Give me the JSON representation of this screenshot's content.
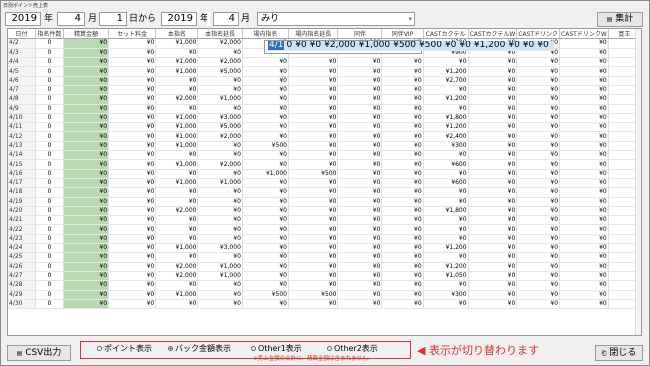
{
  "window_title": "日別ポイント売上表",
  "filter": {
    "from_year": "2019",
    "year_label1": "年",
    "from_month": "4",
    "month_label1": "月",
    "from_day": "1",
    "from_label": "日から",
    "to_year": "2019",
    "year_label2": "年",
    "to_month": "4",
    "month_label2": "月",
    "to_day": "30",
    "to_label": "日まで",
    "cast": "みり"
  },
  "buttons": {
    "aggregate": "集計",
    "csv": "CSV出力",
    "close": "閉じる"
  },
  "columns": [
    "日付",
    "指名件数",
    "精算金額",
    "セット料金",
    "本指名",
    "本指名延長",
    "場内指名",
    "場内指名延長",
    "同伴",
    "同伴VIP",
    "CASTカクテル",
    "CASTカクテルW",
    "CASTドリンク",
    "CASTドリンクW",
    "寛王"
  ],
  "rows": [
    [
      "4/1",
      "0",
      "¥0",
      "¥0",
      "¥2,000",
      "¥1,000",
      "¥500",
      "¥500",
      "¥0",
      "¥0",
      "¥1,200",
      "¥0",
      "¥0",
      "¥0",
      ""
    ],
    [
      "4/2",
      "0",
      "¥0",
      "¥0",
      "¥1,000",
      "¥2,000",
      "¥0",
      "¥0",
      "¥4,000",
      "¥0",
      "¥300",
      "¥0",
      "¥0",
      "¥0",
      ""
    ],
    [
      "4/3",
      "0",
      "¥0",
      "¥0",
      "¥0",
      "¥0",
      "¥0",
      "¥0",
      "¥0",
      "¥0",
      "¥900",
      "¥0",
      "¥0",
      "¥0",
      ""
    ],
    [
      "4/4",
      "0",
      "¥0",
      "¥0",
      "¥1,000",
      "¥2,000",
      "¥0",
      "¥0",
      "¥0",
      "¥0",
      "¥0",
      "¥0",
      "¥0",
      "¥0",
      ""
    ],
    [
      "4/5",
      "0",
      "¥0",
      "¥0",
      "¥1,000",
      "¥5,000",
      "¥0",
      "¥0",
      "¥0",
      "¥0",
      "¥1,200",
      "¥0",
      "¥0",
      "¥0",
      ""
    ],
    [
      "4/6",
      "0",
      "¥0",
      "¥0",
      "¥0",
      "¥0",
      "¥0",
      "¥0",
      "¥0",
      "¥0",
      "¥2,700",
      "¥0",
      "¥0",
      "¥0",
      ""
    ],
    [
      "4/7",
      "0",
      "¥0",
      "¥0",
      "¥0",
      "¥0",
      "¥0",
      "¥0",
      "¥0",
      "¥0",
      "¥0",
      "¥0",
      "¥0",
      "¥0",
      ""
    ],
    [
      "4/8",
      "0",
      "¥0",
      "¥0",
      "¥2,000",
      "¥1,000",
      "¥0",
      "¥0",
      "¥0",
      "¥0",
      "¥1,200",
      "¥0",
      "¥0",
      "¥0",
      ""
    ],
    [
      "4/9",
      "0",
      "¥0",
      "¥0",
      "¥0",
      "¥0",
      "¥0",
      "¥0",
      "¥0",
      "¥0",
      "¥0",
      "¥0",
      "¥0",
      "¥0",
      ""
    ],
    [
      "4/10",
      "0",
      "¥0",
      "¥0",
      "¥1,000",
      "¥3,000",
      "¥0",
      "¥0",
      "¥0",
      "¥0",
      "¥1,800",
      "¥0",
      "¥0",
      "¥0",
      ""
    ],
    [
      "4/11",
      "0",
      "¥0",
      "¥0",
      "¥1,000",
      "¥5,000",
      "¥0",
      "¥0",
      "¥0",
      "¥0",
      "¥1,200",
      "¥0",
      "¥0",
      "¥0",
      ""
    ],
    [
      "4/12",
      "0",
      "¥0",
      "¥0",
      "¥1,000",
      "¥2,000",
      "¥0",
      "¥0",
      "¥0",
      "¥0",
      "¥2,400",
      "¥0",
      "¥0",
      "¥0",
      ""
    ],
    [
      "4/13",
      "0",
      "¥0",
      "¥0",
      "¥1,000",
      "¥0",
      "¥500",
      "¥0",
      "¥0",
      "¥0",
      "¥300",
      "¥0",
      "¥0",
      "¥0",
      ""
    ],
    [
      "4/14",
      "0",
      "¥0",
      "¥0",
      "¥0",
      "¥0",
      "¥0",
      "¥0",
      "¥0",
      "¥0",
      "¥0",
      "¥0",
      "¥0",
      "¥0",
      ""
    ],
    [
      "4/15",
      "0",
      "¥0",
      "¥0",
      "¥1,000",
      "¥2,000",
      "¥0",
      "¥0",
      "¥0",
      "¥0",
      "¥600",
      "¥0",
      "¥0",
      "¥0",
      ""
    ],
    [
      "4/16",
      "0",
      "¥0",
      "¥0",
      "¥0",
      "¥0",
      "¥1,000",
      "¥500",
      "¥0",
      "¥0",
      "¥0",
      "¥0",
      "¥0",
      "¥0",
      ""
    ],
    [
      "4/17",
      "0",
      "¥0",
      "¥0",
      "¥1,000",
      "¥1,000",
      "¥0",
      "¥0",
      "¥0",
      "¥0",
      "¥600",
      "¥0",
      "¥0",
      "¥0",
      ""
    ],
    [
      "4/18",
      "0",
      "¥0",
      "¥0",
      "¥0",
      "¥0",
      "¥0",
      "¥0",
      "¥0",
      "¥0",
      "¥0",
      "¥0",
      "¥0",
      "¥0",
      ""
    ],
    [
      "4/19",
      "0",
      "¥0",
      "¥0",
      "¥0",
      "¥0",
      "¥0",
      "¥0",
      "¥0",
      "¥0",
      "¥0",
      "¥0",
      "¥0",
      "¥0",
      ""
    ],
    [
      "4/20",
      "0",
      "¥0",
      "¥0",
      "¥2,000",
      "¥0",
      "¥0",
      "¥0",
      "¥0",
      "¥0",
      "¥1,800",
      "¥0",
      "¥0",
      "¥0",
      ""
    ],
    [
      "4/21",
      "0",
      "¥0",
      "¥0",
      "¥0",
      "¥0",
      "¥0",
      "¥0",
      "¥0",
      "¥0",
      "¥0",
      "¥0",
      "¥0",
      "¥0",
      ""
    ],
    [
      "4/22",
      "0",
      "¥0",
      "¥0",
      "¥0",
      "¥0",
      "¥0",
      "¥0",
      "¥0",
      "¥0",
      "¥0",
      "¥0",
      "¥0",
      "¥0",
      ""
    ],
    [
      "4/23",
      "0",
      "¥0",
      "¥0",
      "¥0",
      "¥0",
      "¥0",
      "¥0",
      "¥0",
      "¥0",
      "¥0",
      "¥0",
      "¥0",
      "¥0",
      ""
    ],
    [
      "4/24",
      "0",
      "¥0",
      "¥0",
      "¥1,000",
      "¥3,000",
      "¥0",
      "¥0",
      "¥0",
      "¥0",
      "¥1,200",
      "¥0",
      "¥0",
      "¥0",
      ""
    ],
    [
      "4/25",
      "0",
      "¥0",
      "¥0",
      "¥0",
      "¥0",
      "¥0",
      "¥0",
      "¥0",
      "¥0",
      "¥0",
      "¥0",
      "¥0",
      "¥0",
      ""
    ],
    [
      "4/26",
      "0",
      "¥0",
      "¥0",
      "¥2,000",
      "¥1,000",
      "¥0",
      "¥0",
      "¥0",
      "¥0",
      "¥1,200",
      "¥0",
      "¥0",
      "¥0",
      ""
    ],
    [
      "4/27",
      "0",
      "¥0",
      "¥0",
      "¥2,000",
      "¥1,000",
      "¥0",
      "¥0",
      "¥0",
      "¥0",
      "¥1,050",
      "¥0",
      "¥0",
      "¥0",
      ""
    ],
    [
      "4/28",
      "0",
      "¥0",
      "¥0",
      "¥0",
      "¥0",
      "¥0",
      "¥0",
      "¥0",
      "¥0",
      "¥0",
      "¥0",
      "¥0",
      "¥0",
      ""
    ],
    [
      "4/29",
      "0",
      "¥0",
      "¥0",
      "¥1,000",
      "¥0",
      "¥500",
      "¥500",
      "¥0",
      "¥0",
      "¥300",
      "¥0",
      "¥0",
      "¥0",
      ""
    ],
    [
      "4/30",
      "0",
      "¥0",
      "¥0",
      "¥0",
      "¥0",
      "¥0",
      "¥0",
      "¥0",
      "¥0",
      "¥0",
      "¥0",
      "¥0",
      "¥0",
      ""
    ]
  ],
  "radios": [
    {
      "label": "ポイント表示",
      "selected": false
    },
    {
      "label": "バック金額表示",
      "selected": true
    },
    {
      "label": "Other1表示",
      "selected": false
    },
    {
      "label": "Other2表示",
      "selected": false
    }
  ],
  "note": "※売上金額の合計に、精算金額は含まれません。",
  "callout": "表示が切り替わります",
  "accent": "#e03030"
}
